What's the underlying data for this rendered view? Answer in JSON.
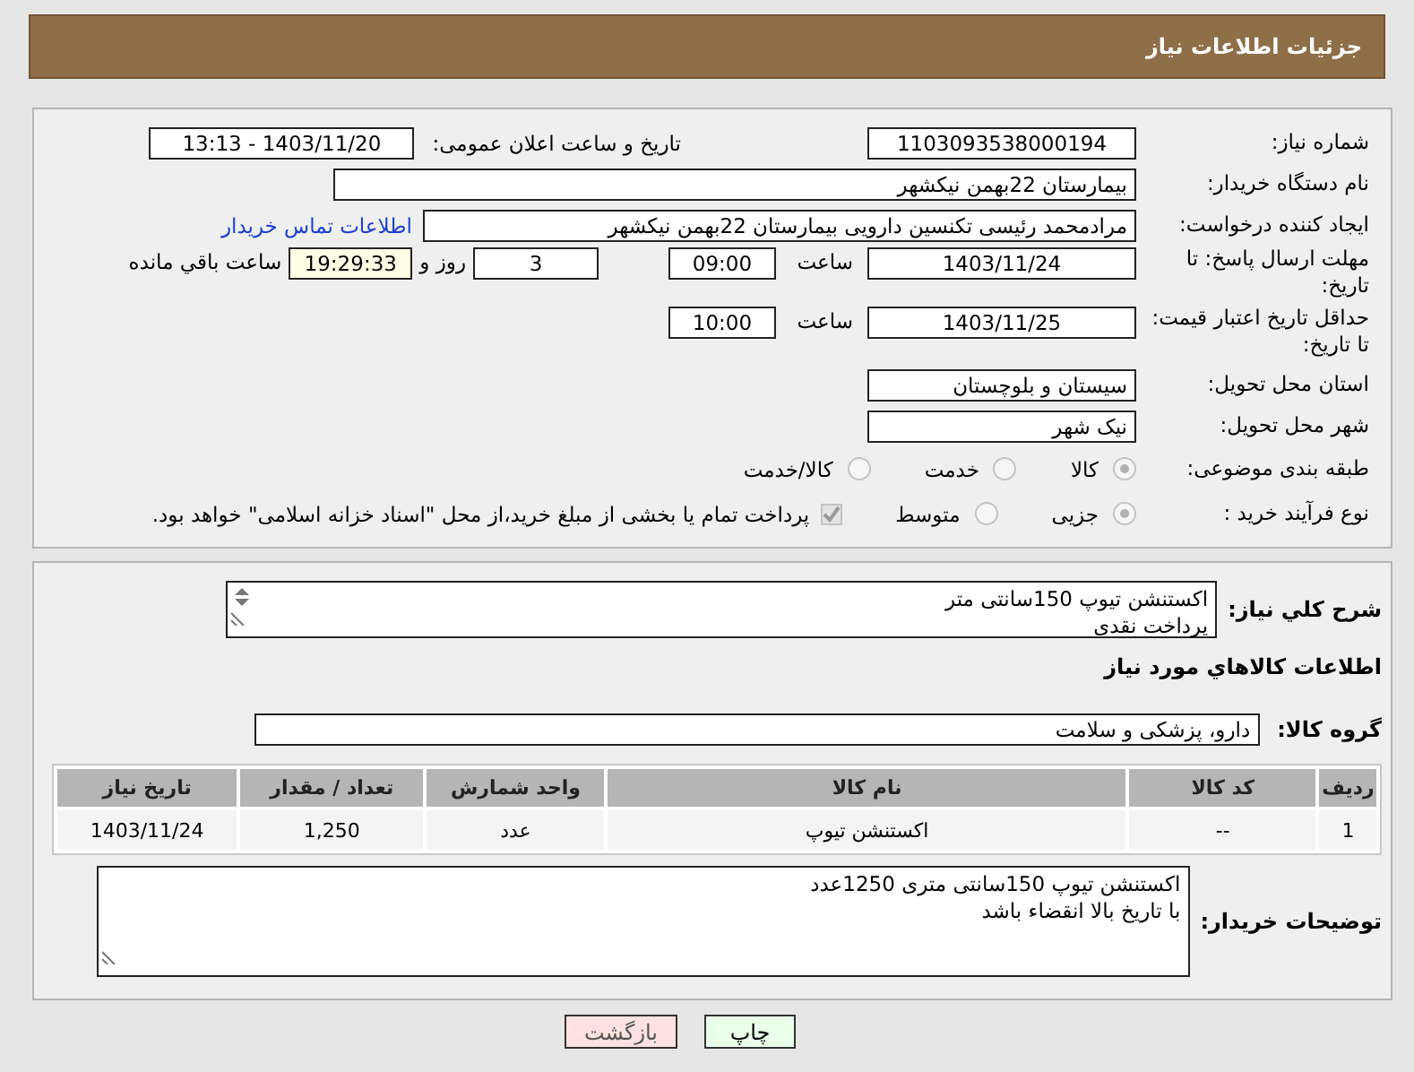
{
  "header": {
    "title": "جزئیات اطلاعات نیاز"
  },
  "details": {
    "need_number": {
      "label": "شماره نیاز:",
      "value": "1103093538000194"
    },
    "announce": {
      "label": "تاریخ و ساعت اعلان عمومی:",
      "value": "1403/11/20 - 13:13"
    },
    "buyer_org": {
      "label": "نام دستگاه خریدار:",
      "value": "بیمارستان 22بهمن نیکشهر"
    },
    "creator": {
      "label": "ایجاد کننده درخواست:",
      "value": "مرادمحمد رئیسی تکنسین دارویی بیمارستان 22بهمن نیکشهر",
      "link": "اطلاعات تماس خریدار"
    },
    "reply_deadline": {
      "label": "مهلت ارسال پاسخ: تا تاریخ:",
      "date": "1403/11/24",
      "time_label": "ساعت",
      "time": "09:00",
      "days": "3",
      "days_label": "روز و",
      "remaining": "19:29:33",
      "remaining_label": "ساعت باقي مانده"
    },
    "price_validity": {
      "label": "حداقل تاریخ اعتبار قیمت: تا تاریخ:",
      "date": "1403/11/25",
      "time_label": "ساعت",
      "time": "10:00"
    },
    "province": {
      "label": "استان محل تحویل:",
      "value": "سیستان و بلوچستان"
    },
    "city": {
      "label": "شهر محل تحویل:",
      "value": "نیک شهر"
    },
    "category": {
      "label": "طبقه بندی موضوعی:",
      "options": [
        {
          "label": "کالا",
          "selected": true
        },
        {
          "label": "خدمت",
          "selected": false
        },
        {
          "label": "کالا/خدمت",
          "selected": false
        }
      ]
    },
    "purchase_type": {
      "label": "نوع فرآیند خرید :",
      "options": [
        {
          "label": "جزیی",
          "selected": true
        },
        {
          "label": "متوسط",
          "selected": false
        }
      ],
      "treasury": {
        "checked": true,
        "text": "پرداخت تمام یا بخشی از مبلغ خرید،از محل \"اسناد خزانه اسلامی\" خواهد بود."
      }
    }
  },
  "items": {
    "description": {
      "label": "شرح کلي نياز:",
      "value": "اکستنشن تیوپ 150سانتی متر\nپرداخت نقدی"
    },
    "heading": "اطلاعات كالاهاي مورد نياز",
    "goods_group": {
      "label": "گروه کالا:",
      "value": "دارو، پزشکی و سلامت"
    },
    "table": {
      "columns": [
        "ردیف",
        "کد کالا",
        "نام کالا",
        "واحد شمارش",
        "تعداد / مقدار",
        "تاریخ نیاز"
      ],
      "rows": [
        [
          "1",
          "--",
          "اکستنشن تیوپ",
          "عدد",
          "1,250",
          "1403/11/24"
        ]
      ]
    },
    "buyer_notes": {
      "label": "توضیحات خریدار:",
      "value": "اکستنشن تیوپ 150سانتی متری 1250عدد\nبا تاریخ بالا انقضاء باشد"
    }
  },
  "buttons": [
    {
      "label": "چاپ",
      "kind": "print"
    },
    {
      "label": "بازگشت",
      "kind": "back"
    }
  ]
}
